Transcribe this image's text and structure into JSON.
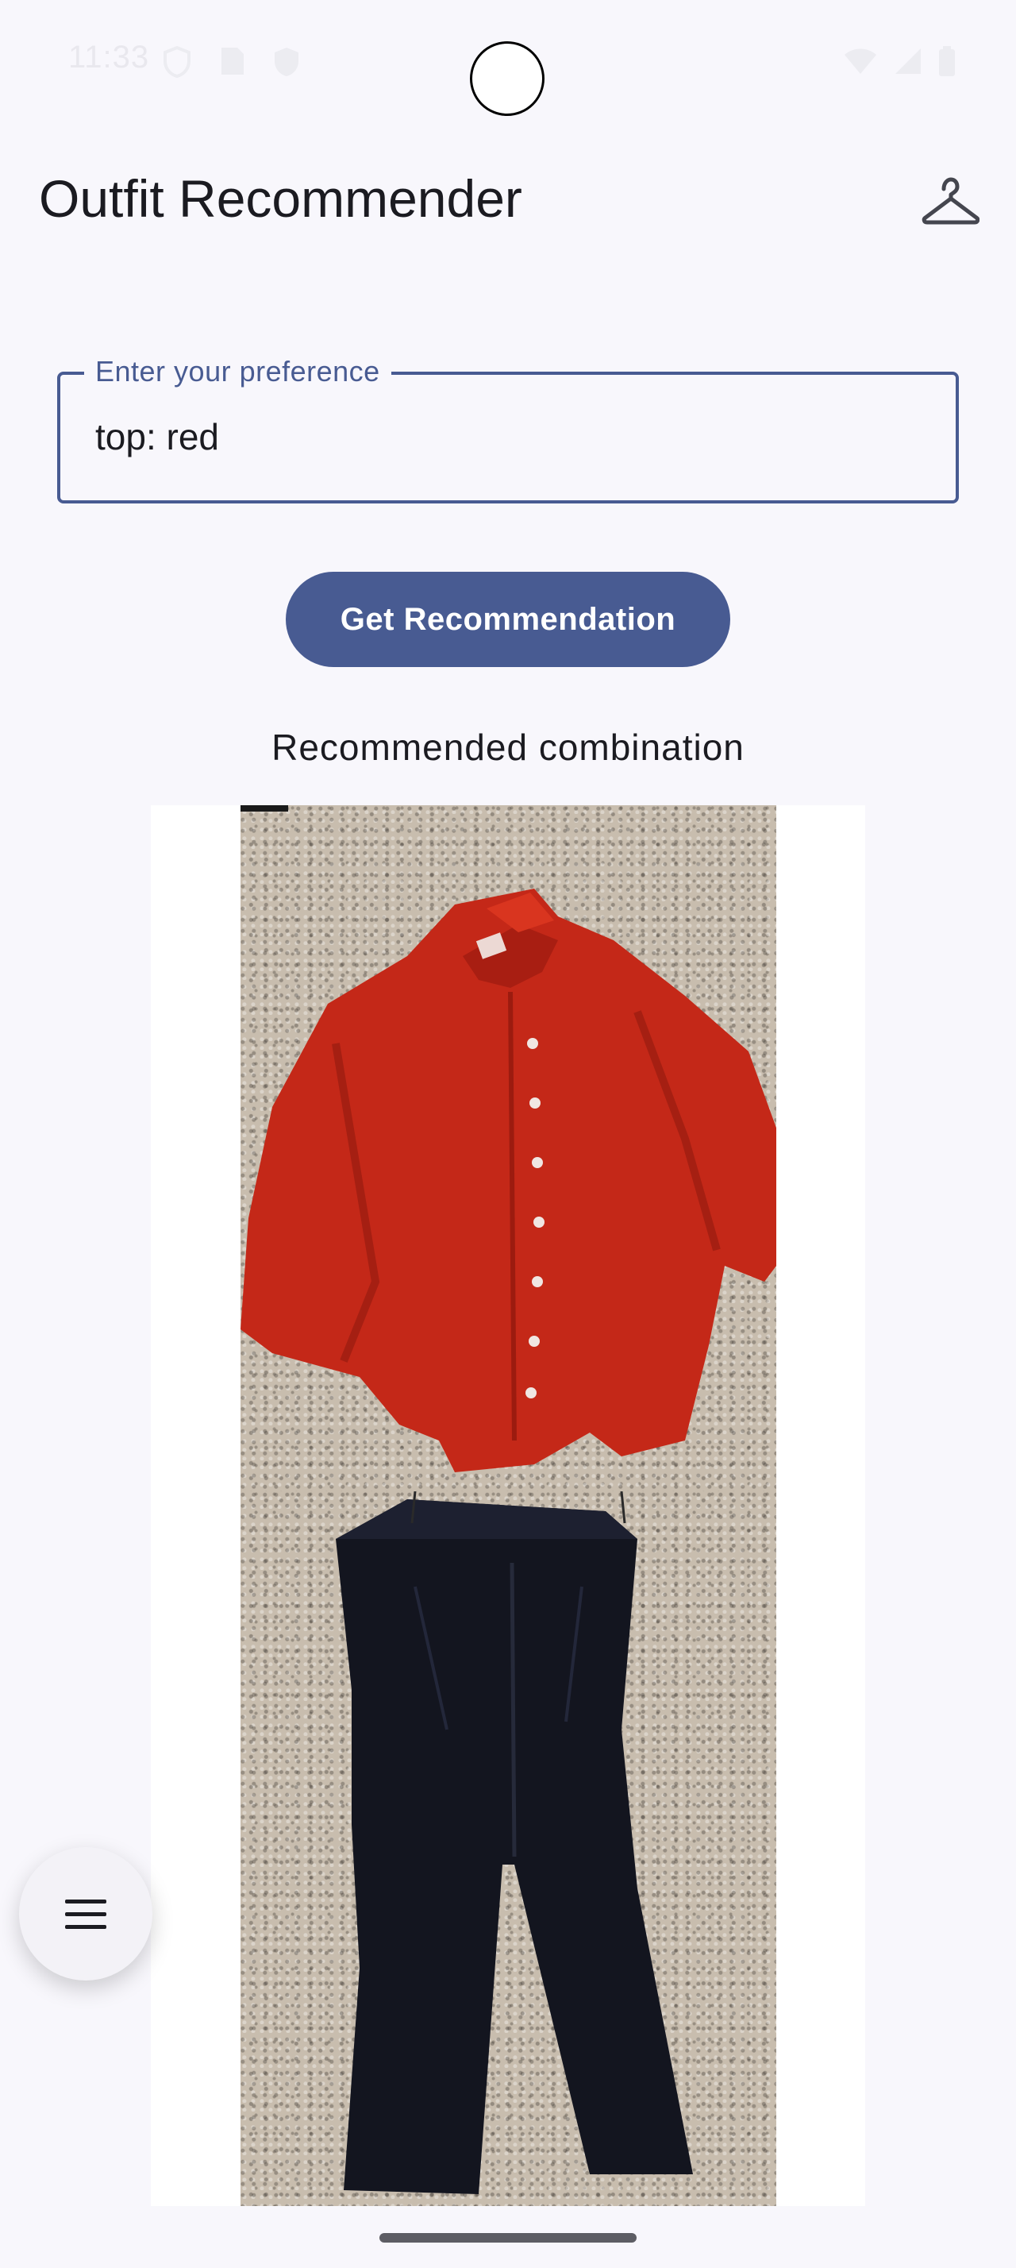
{
  "status_bar": {
    "time": "11:33",
    "icons": [
      "shield-icon",
      "sim-icon",
      "shield-check-icon"
    ],
    "right_icons": [
      "wifi-icon",
      "cellular-signal-icon",
      "battery-icon"
    ]
  },
  "app_bar": {
    "title": "Outfit Recommender",
    "action_icon": "hanger-icon"
  },
  "preference_field": {
    "label": "Enter your preference",
    "value": "top: red"
  },
  "recommend_button": {
    "label": "Get Recommendation"
  },
  "result": {
    "heading": "Recommended combination",
    "items": [
      {
        "type": "top",
        "color_name": "red",
        "color": "#c42818"
      },
      {
        "type": "bottom",
        "color_name": "black",
        "color": "#13151f"
      }
    ]
  },
  "fab": {
    "icon": "menu-icon"
  },
  "colors": {
    "background": "#f8f7fc",
    "primary": "#485b92",
    "on_primary": "#ffffff",
    "text": "#1b1b21"
  }
}
